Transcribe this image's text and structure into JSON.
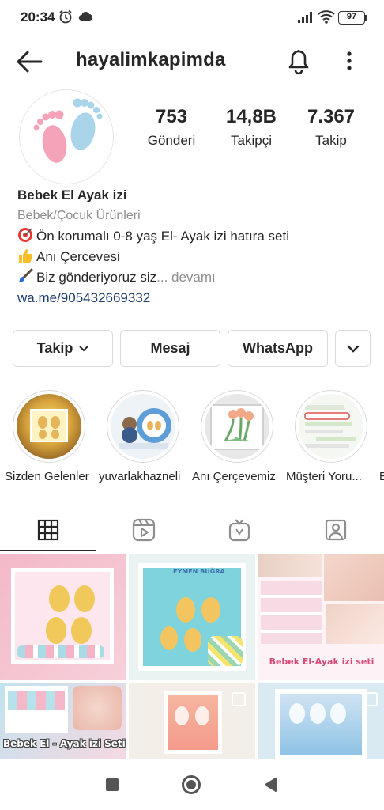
{
  "status_bar": {
    "time": "20:34",
    "battery": "97"
  },
  "header": {
    "username": "hayalimkapimda"
  },
  "stats": [
    {
      "value": "753",
      "label": "Gönderi"
    },
    {
      "value": "14,8B",
      "label": "Takipçi"
    },
    {
      "value": "7.367",
      "label": "Takip"
    }
  ],
  "bio": {
    "name": "Bebek El Ayak izi",
    "category": "Bebek/Çocuk Ürünleri",
    "line1": "Ön korumalı 0-8 yaş El- Ayak izi hatıra seti",
    "line2": "Anı Çercevesi",
    "line3": "Biz gönderiyoruz siz",
    "more": "... devamı",
    "link": "wa.me/905432669332"
  },
  "buttons": {
    "follow": "Takip",
    "message": "Mesaj",
    "whatsapp": "WhatsApp"
  },
  "highlights": [
    {
      "label": "Sizden Gelenler"
    },
    {
      "label": "yuvarlakhazneli"
    },
    {
      "label": "Anı Çerçevemiz"
    },
    {
      "label": "Müşteri Yoru..."
    }
  ],
  "posts": [
    {
      "caption": ""
    },
    {
      "caption": "EYMEN BUĞRA"
    },
    {
      "caption": "Bebek El-Ayak izi seti"
    },
    {
      "caption": "Bebek El - Ayak izi Seti"
    },
    {
      "caption": ""
    },
    {
      "caption": ""
    }
  ],
  "colors": {
    "text": "#262626",
    "secondary": "#8e8e8e",
    "link": "#1c3a6e",
    "border": "#dbdbdb",
    "pink": "#f4a3b9",
    "blue": "#a9d4ea"
  },
  "icons": {
    "back": "arrow-left-icon",
    "notifications": "bell-icon",
    "more": "more-vertical-icon",
    "grid": "grid-icon",
    "reels": "reels-icon",
    "igtv": "tv-icon",
    "tagged": "tagged-person-icon"
  }
}
